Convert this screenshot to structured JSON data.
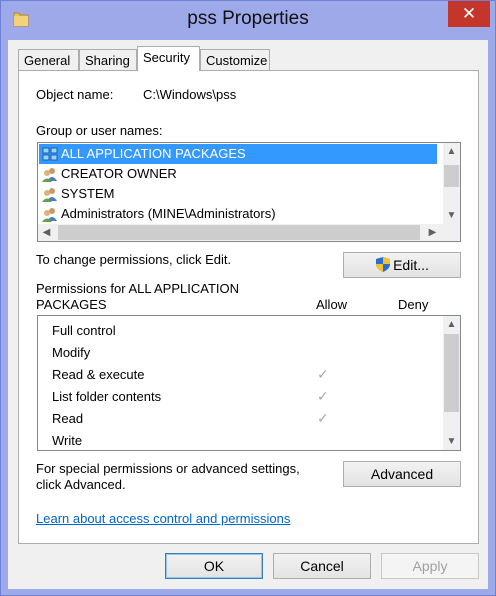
{
  "window": {
    "title": "pss Properties",
    "close_glyph": "✕",
    "icon": "folder-icon"
  },
  "tabs": [
    {
      "label": "General",
      "active": false
    },
    {
      "label": "Sharing",
      "active": false
    },
    {
      "label": "Security",
      "active": true
    },
    {
      "label": "Customize",
      "active": false
    }
  ],
  "security": {
    "object_name_label": "Object name:",
    "object_name_value": "C:\\Windows\\pss",
    "group_label": "Group or user names:",
    "users": [
      {
        "name": "ALL APPLICATION PACKAGES",
        "selected": true,
        "icon": "app-packages-icon"
      },
      {
        "name": "CREATOR OWNER",
        "selected": false,
        "icon": "users-icon"
      },
      {
        "name": "SYSTEM",
        "selected": false,
        "icon": "users-icon"
      },
      {
        "name": "Administrators (MINE\\Administrators)",
        "selected": false,
        "icon": "users-icon"
      }
    ],
    "change_hint": "To change permissions, click Edit.",
    "edit_label": "Edit...",
    "permissions_for_line1": "Permissions for ALL APPLICATION",
    "permissions_for_line2": "PACKAGES",
    "allow_header": "Allow",
    "deny_header": "Deny",
    "permissions": [
      {
        "name": "Full control",
        "allow": false,
        "deny": false
      },
      {
        "name": "Modify",
        "allow": false,
        "deny": false
      },
      {
        "name": "Read & execute",
        "allow": true,
        "deny": false
      },
      {
        "name": "List folder contents",
        "allow": true,
        "deny": false
      },
      {
        "name": "Read",
        "allow": true,
        "deny": false
      },
      {
        "name": "Write",
        "allow": false,
        "deny": false
      }
    ],
    "check_glyph": "✓",
    "special_line1": "For special permissions or advanced settings,",
    "special_line2": "click Advanced.",
    "advanced_label": "Advanced",
    "learn_link": "Learn about access control and permissions"
  },
  "footer": {
    "ok_label": "OK",
    "cancel_label": "Cancel",
    "apply_label": "Apply"
  },
  "colors": {
    "frame": "#9ea9ea",
    "close": "#c5362a",
    "selection": "#3399ff",
    "link": "#0066cc"
  }
}
